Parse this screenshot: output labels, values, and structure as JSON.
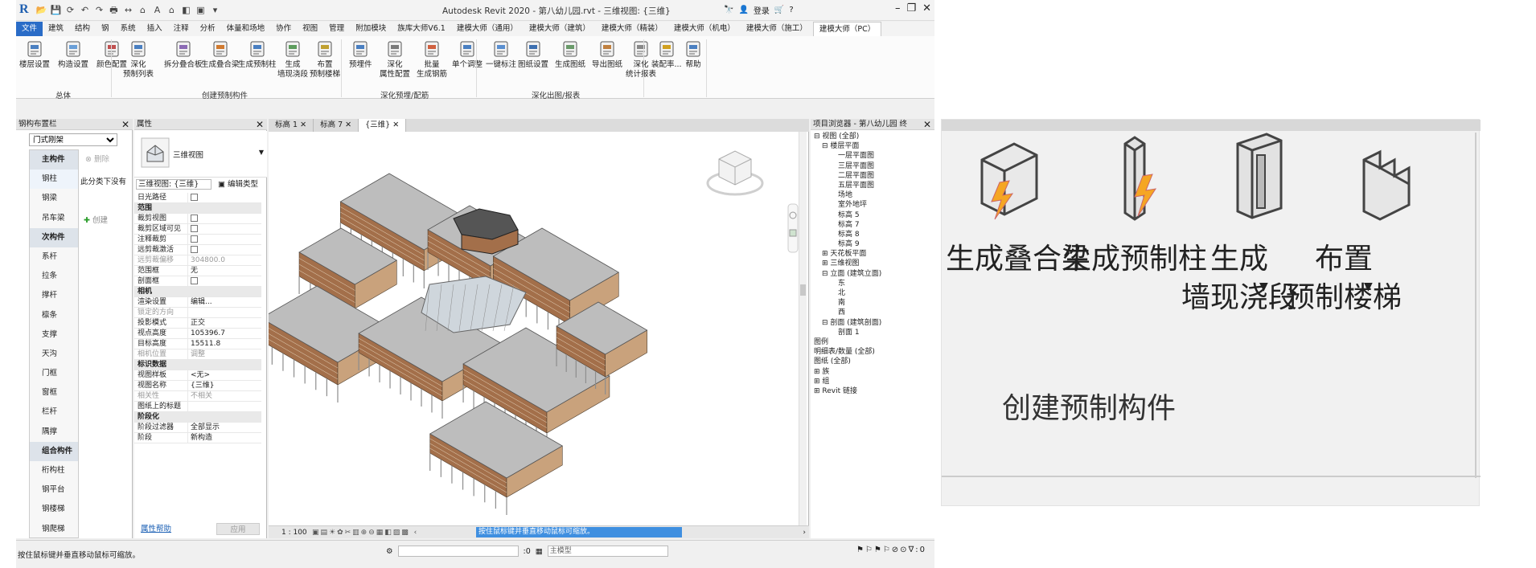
{
  "window": {
    "title": "Autodesk Revit 2020 - 第八幼儿园.rvt - 三维视图: {三维}",
    "login": "登录",
    "quick_access": [
      "open",
      "save",
      "sync",
      "undo",
      "redo",
      "print",
      "measure",
      "tag",
      "text-A",
      "3d",
      "section",
      "close-hidden",
      "switch"
    ]
  },
  "tabs": [
    "文件",
    "建筑",
    "结构",
    "钢",
    "系统",
    "插入",
    "注释",
    "分析",
    "体量和场地",
    "协作",
    "视图",
    "管理",
    "附加模块",
    "族库大师V6.1",
    "建模大师（通用）",
    "建模大师（建筑）",
    "建模大师（精装）",
    "建模大师（机电）",
    "建模大师（施工）",
    "建模大师（PC）"
  ],
  "active_tab": "建模大师（PC）",
  "ribbon": {
    "groups": [
      {
        "label": "总体",
        "buttons": [
          {
            "label": "楼层设置"
          },
          {
            "label": "构造设置"
          },
          {
            "label": "颜色配置"
          }
        ]
      },
      {
        "label": "创建预制构件",
        "buttons": [
          {
            "label": "深化\n预制列表"
          },
          {
            "label": "拆分叠合板"
          },
          {
            "label": "生成叠合梁"
          },
          {
            "label": "生成预制柱"
          },
          {
            "label": "生成\n墙现浇段"
          },
          {
            "label": "布置\n预制楼梯"
          }
        ]
      },
      {
        "label": "深化预埋/配筋",
        "buttons": [
          {
            "label": "预埋件"
          },
          {
            "label": "深化\n属性配置"
          },
          {
            "label": "批量\n生成钢筋"
          },
          {
            "label": "单个调整"
          }
        ]
      },
      {
        "label": "深化出图/报表",
        "buttons": [
          {
            "label": "一键标注"
          },
          {
            "label": "图纸设置"
          },
          {
            "label": "生成图纸"
          },
          {
            "label": "导出图纸"
          },
          {
            "label": "深化\n统计报表"
          }
        ]
      },
      {
        "label": "",
        "buttons": [
          {
            "label": "装配率..."
          },
          {
            "label": "帮助"
          }
        ]
      }
    ]
  },
  "rebar_panel": {
    "title": "钢构布置栏",
    "dropdown": "门式刚架",
    "side_text": "此分类下没有",
    "create_label": "创建",
    "delete_label": "删除",
    "items": [
      {
        "label": "主构件",
        "cat": true
      },
      {
        "label": "钢柱"
      },
      {
        "label": "钢梁"
      },
      {
        "label": "吊车梁"
      },
      {
        "label": "次构件",
        "cat": true
      },
      {
        "label": "系杆"
      },
      {
        "label": "拉条"
      },
      {
        "label": "撑杆"
      },
      {
        "label": "檩条"
      },
      {
        "label": "支撑"
      },
      {
        "label": "天沟"
      },
      {
        "label": "门框"
      },
      {
        "label": "窗框"
      },
      {
        "label": "栏杆"
      },
      {
        "label": "隅撑"
      },
      {
        "label": "组合构件",
        "cat": true
      },
      {
        "label": "桁构柱"
      },
      {
        "label": "钢平台"
      },
      {
        "label": "钢楼梯"
      },
      {
        "label": "钢爬梯"
      }
    ]
  },
  "properties": {
    "title": "属性",
    "type_name": "三维视图",
    "selector": "三维视图: {三维}",
    "edit_type": "编辑类型",
    "rows": [
      {
        "k": "日光路径",
        "v": "",
        "cb": true
      },
      {
        "k": "范围",
        "sec": true
      },
      {
        "k": "裁剪视图",
        "v": "",
        "cb": true
      },
      {
        "k": "裁剪区域可见",
        "v": "",
        "cb": true
      },
      {
        "k": "注释裁剪",
        "v": "",
        "cb": true
      },
      {
        "k": "远剪裁激活",
        "v": "",
        "cb": true
      },
      {
        "k": "远剪裁偏移",
        "v": "304800.0",
        "dis": true
      },
      {
        "k": "范围框",
        "v": "无"
      },
      {
        "k": "剖面框",
        "v": "",
        "cb": true
      },
      {
        "k": "相机",
        "sec": true
      },
      {
        "k": "渲染设置",
        "v": "编辑..."
      },
      {
        "k": "锁定的方向",
        "v": "",
        "dis": true
      },
      {
        "k": "投影模式",
        "v": "正交"
      },
      {
        "k": "视点高度",
        "v": "105396.7"
      },
      {
        "k": "目标高度",
        "v": "15511.8"
      },
      {
        "k": "相机位置",
        "v": "调整",
        "dis": true
      },
      {
        "k": "标识数据",
        "sec": true
      },
      {
        "k": "视图样板",
        "v": "<无>"
      },
      {
        "k": "视图名称",
        "v": "{三维}"
      },
      {
        "k": "相关性",
        "v": "不相关",
        "dis": true
      },
      {
        "k": "图纸上的标题",
        "v": ""
      },
      {
        "k": "阶段化",
        "sec": true
      },
      {
        "k": "阶段过滤器",
        "v": "全部显示"
      },
      {
        "k": "阶段",
        "v": "新构造"
      }
    ],
    "help": "属性帮助",
    "apply": "应用"
  },
  "view": {
    "tabs": [
      "标高 1",
      "标高 7",
      "{三维}"
    ],
    "scale": "1 : 100",
    "hint": "按住鼠标键并垂直移动鼠标可缩放。"
  },
  "browser": {
    "title": "项目浏览器 - 第八幼儿园 终",
    "tree": [
      {
        "t": "视图 (全部)",
        "d": 0,
        "exp": "-"
      },
      {
        "t": "楼层平面",
        "d": 1,
        "exp": "-"
      },
      {
        "t": "一层平面图",
        "d": 3
      },
      {
        "t": "三层平面图",
        "d": 3
      },
      {
        "t": "二层平面图",
        "d": 3
      },
      {
        "t": "五层平面图",
        "d": 3
      },
      {
        "t": "场地",
        "d": 3
      },
      {
        "t": "室外地坪",
        "d": 3
      },
      {
        "t": "标高 5",
        "d": 3
      },
      {
        "t": "标高 7",
        "d": 3
      },
      {
        "t": "标高 8",
        "d": 3
      },
      {
        "t": "标高 9",
        "d": 3
      },
      {
        "t": "天花板平面",
        "d": 1,
        "exp": "+"
      },
      {
        "t": "三维视图",
        "d": 1,
        "exp": "+"
      },
      {
        "t": "立面 (建筑立面)",
        "d": 1,
        "exp": "-"
      },
      {
        "t": "东",
        "d": 3
      },
      {
        "t": "北",
        "d": 3
      },
      {
        "t": "南",
        "d": 3
      },
      {
        "t": "西",
        "d": 3
      },
      {
        "t": "剖面 (建筑剖面)",
        "d": 1,
        "exp": "-"
      },
      {
        "t": "剖面 1",
        "d": 3
      },
      {
        "t": "图例",
        "d": 0
      },
      {
        "t": "明细表/数量 (全部)",
        "d": 0
      },
      {
        "t": "图纸 (全部)",
        "d": 0
      },
      {
        "t": "族",
        "d": 0,
        "exp": "+"
      },
      {
        "t": "组",
        "d": 0,
        "exp": "+"
      },
      {
        "t": "Revit 链接",
        "d": 0,
        "exp": "+"
      }
    ]
  },
  "status": {
    "message": "按住鼠标键并垂直移动鼠标可缩放。",
    "zero": ":0",
    "model": "主模型",
    "filter": ":0"
  },
  "zoom": {
    "buttons": [
      "生成叠合梁",
      "生成预制柱",
      "生成\n墙现浇段",
      "布置\n预制楼梯"
    ],
    "group_label": "创建预制构件"
  },
  "colors": {
    "file_tab": "#2a6cc7",
    "roof": "#bdbdbd",
    "wall": "#a36f4a",
    "column": "#8d8d8d"
  }
}
